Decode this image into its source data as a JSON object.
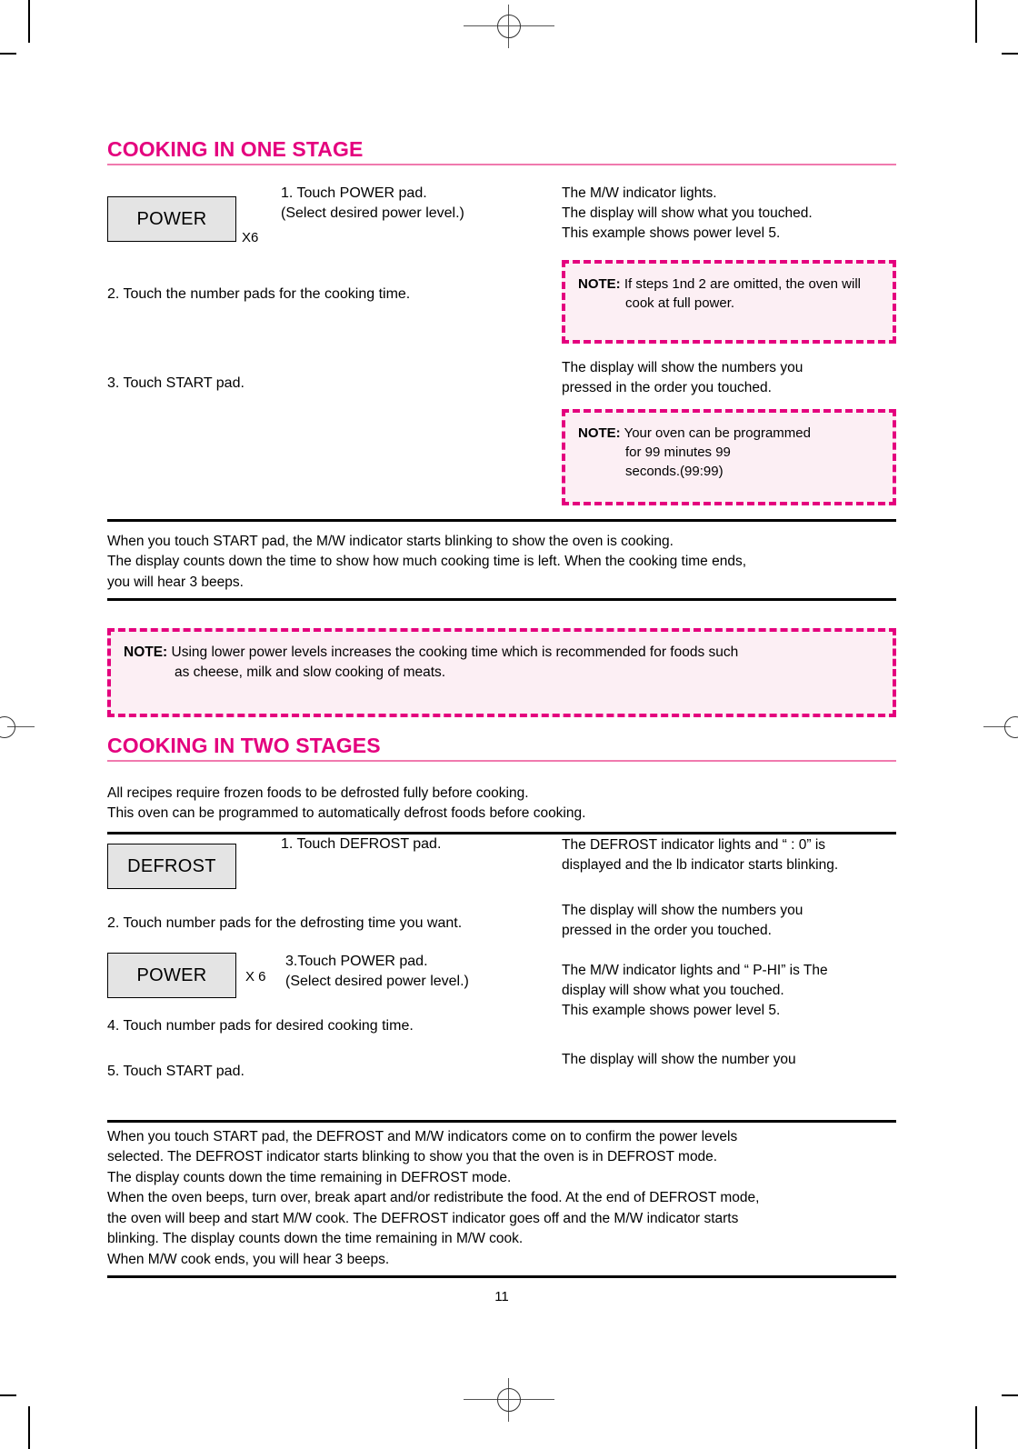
{
  "document": {
    "page_number": "11",
    "accent_color": "#E4007E",
    "title_rule_color": "#F07AAE",
    "note_fill_color": "#FCEFF4",
    "pad_fill_color": "#E4E4E4"
  },
  "section_one": {
    "title": "COOKING IN ONE STAGE",
    "step1": {
      "pad_label": "POWER",
      "multiplier": "X6",
      "instruction_line1": "1. Touch POWER pad.",
      "instruction_line2": "(Select desired power level.)",
      "result_line1": "The M/W indicator lights.",
      "result_line2": "The display will show what you touched.",
      "result_line3": "This example shows power level 5."
    },
    "note1": {
      "label": "NOTE:",
      "text": "If steps 1nd 2 are omitted, the oven will cook at full power."
    },
    "step2": {
      "instruction": "2. Touch the number pads for the cooking time."
    },
    "step3": {
      "instruction": "3. Touch START pad.",
      "result_line1": "The display will show the numbers you",
      "result_line2": "pressed in the order you touched."
    },
    "note2": {
      "label": "NOTE:",
      "line1": "Your oven can be programmed",
      "line2": "for 99 minutes 99",
      "line3": "seconds.(99:99)"
    },
    "summary": {
      "line1": "When you touch START pad, the M/W indicator starts blinking to show the oven is cooking.",
      "line2": "The display counts down the time to show how much cooking time is left. When the cooking time ends,",
      "line3": "you will hear 3 beeps."
    },
    "note3": {
      "label": "NOTE:",
      "line1": "Using lower power levels increases the cooking time which is recommended for foods such",
      "line2": "as cheese, milk and slow cooking of meats."
    }
  },
  "section_two": {
    "title": "COOKING IN TWO STAGES",
    "intro_line1": "All recipes require frozen foods to be defrosted fully before cooking.",
    "intro_line2": "This oven can be programmed to automatically defrost foods before cooking.",
    "step1": {
      "pad_label": "DEFROST",
      "instruction": "1. Touch DEFROST pad.",
      "result_line1": "The DEFROST indicator lights and “ : 0” is",
      "result_line2": "displayed and the lb indicator starts blinking."
    },
    "step2": {
      "instruction": "2. Touch number pads for the defrosting time you want.",
      "result_line1": "The display will show the numbers you",
      "result_line2": "pressed in the order you touched."
    },
    "step3": {
      "pad_label": "POWER",
      "multiplier": "X 6",
      "instruction_line1": "3.Touch POWER pad.",
      "instruction_line2": "(Select desired power level.)",
      "result_line1": "The M/W indicator lights and “ P-HI” is The",
      "result_line2": "display will show what you touched.",
      "result_line3": "This example shows power level 5."
    },
    "step4": {
      "instruction": "4. Touch number pads for desired cooking time."
    },
    "step5": {
      "instruction": "5. Touch START pad.",
      "result_line1": "The display will show the number you"
    },
    "summary": {
      "line1": "When you touch START pad, the DEFROST and M/W indicators come on to confirm the power levels",
      "line2": "selected. The DEFROST indicator starts blinking to show you that the oven is in DEFROST mode.",
      "line3": "The display counts down the time remaining in DEFROST mode.",
      "line4": "When the oven beeps, turn over, break apart and/or redistribute the food. At the end of DEFROST mode,",
      "line5": "the oven will beep and start M/W cook. The DEFROST indicator goes off and the M/W indicator starts",
      "line6": "blinking. The display counts down the time remaining in M/W cook.",
      "line7": "When M/W cook ends, you will hear 3 beeps."
    }
  }
}
